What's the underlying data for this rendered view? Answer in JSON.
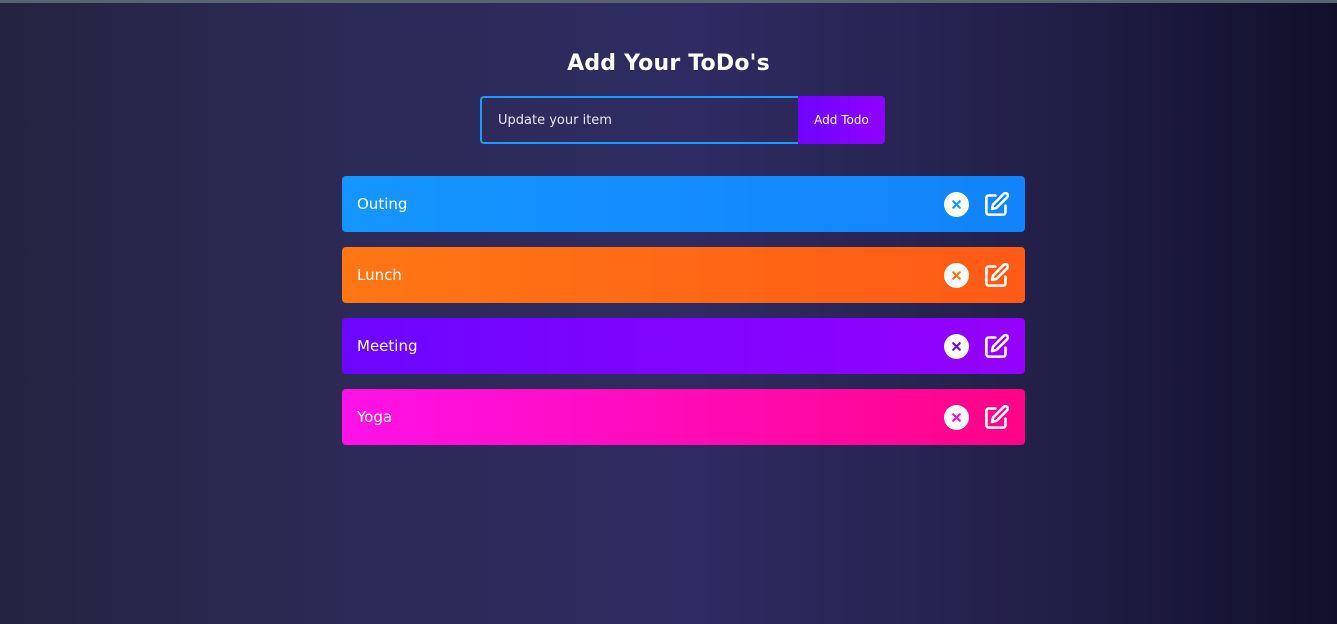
{
  "title": "Add Your ToDo's",
  "form": {
    "placeholder": "Update your item",
    "value": "",
    "button_label": "Add Todo"
  },
  "todos": [
    {
      "text": "Outing",
      "color_start": "#1596ff",
      "color_end": "#1283fa",
      "accent": "#1596ff"
    },
    {
      "text": "Lunch",
      "color_start": "#ff7614",
      "color_end": "#ff5a16",
      "accent": "#ff7614"
    },
    {
      "text": "Meeting",
      "color_start": "#6b06ff",
      "color_end": "#9402fd",
      "accent": "#7006ff"
    },
    {
      "text": "Yoga",
      "color_start": "#ff12e8",
      "color_end": "#ff0485",
      "accent": "#ff10d0"
    }
  ]
}
